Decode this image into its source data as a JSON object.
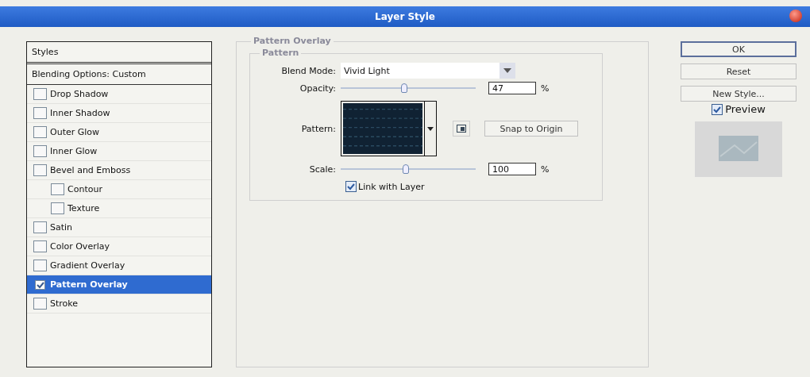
{
  "window": {
    "title": "Layer Style"
  },
  "styles": {
    "header": "Styles",
    "blending_options": "Blending Options: Custom",
    "items": [
      {
        "label": "Drop Shadow",
        "checked": false,
        "selected": false
      },
      {
        "label": "Inner Shadow",
        "checked": false,
        "selected": false
      },
      {
        "label": "Outer Glow",
        "checked": false,
        "selected": false
      },
      {
        "label": "Inner Glow",
        "checked": false,
        "selected": false
      },
      {
        "label": "Bevel and Emboss",
        "checked": false,
        "selected": false,
        "children": [
          {
            "label": "Contour",
            "checked": false,
            "selected": false
          },
          {
            "label": "Texture",
            "checked": false,
            "selected": false
          }
        ]
      },
      {
        "label": "Satin",
        "checked": false,
        "selected": false
      },
      {
        "label": "Color Overlay",
        "checked": false,
        "selected": false
      },
      {
        "label": "Gradient Overlay",
        "checked": false,
        "selected": false
      },
      {
        "label": "Pattern Overlay",
        "checked": true,
        "selected": true
      },
      {
        "label": "Stroke",
        "checked": false,
        "selected": false
      }
    ]
  },
  "panel": {
    "title": "Pattern Overlay",
    "group": "Pattern",
    "blend_mode": {
      "label": "Blend Mode:",
      "value": "Vivid Light"
    },
    "opacity": {
      "label": "Opacity:",
      "level": 0.47,
      "value": "47",
      "unit": "%"
    },
    "pattern": {
      "label": "Pattern:",
      "snap_button": "Snap to Origin"
    },
    "scale": {
      "label": "Scale:",
      "level": 0.48,
      "value": "100",
      "unit": "%"
    },
    "link": {
      "label": "Link with Layer",
      "checked": true
    }
  },
  "buttons": [
    {
      "label": "OK",
      "default": true
    },
    {
      "label": "Reset",
      "default": false
    },
    {
      "label": "New Style...",
      "default": false
    }
  ],
  "preview": {
    "label": "Preview",
    "checked": true
  }
}
